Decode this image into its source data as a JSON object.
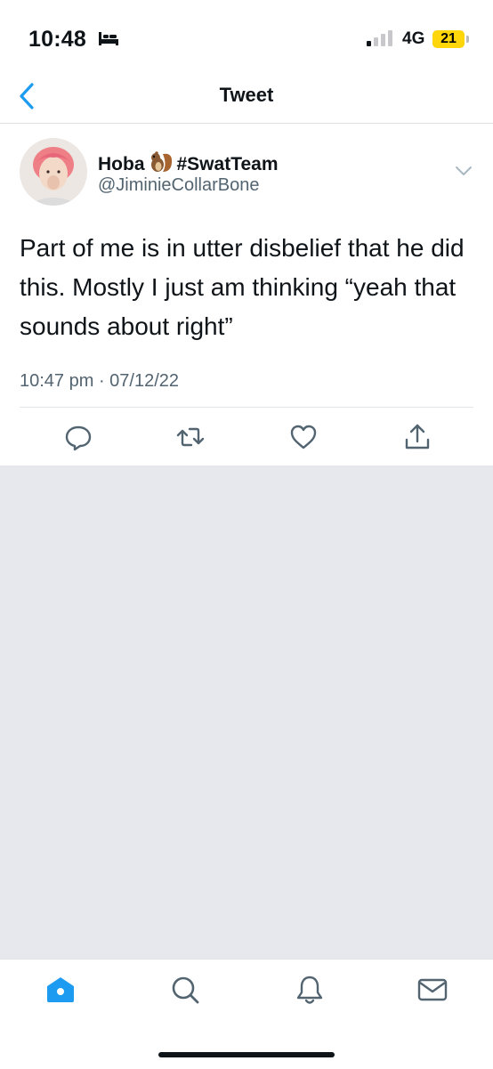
{
  "status_bar": {
    "time": "10:48",
    "network": "4G",
    "battery": "21"
  },
  "nav": {
    "title": "Tweet"
  },
  "tweet": {
    "display_name": "Hoba",
    "display_name_suffix": "#SwatTeam",
    "handle": "@JiminieCollarBone",
    "text": "Part of me is in utter disbelief that he did this. Mostly I just am thinking “yeah that sounds about right”",
    "timestamp": "10:47 pm · 07/12/22"
  },
  "icons": {
    "back": "chevron-left-icon",
    "caret": "chevron-down-icon",
    "reply": "reply-icon",
    "retweet": "retweet-icon",
    "like": "heart-icon",
    "share": "share-icon",
    "home": "home-icon",
    "search": "search-icon",
    "notifications": "bell-icon",
    "messages": "mail-icon"
  },
  "colors": {
    "accent": "#1d9bf0",
    "icon_gray": "#536471",
    "background_empty": "#e6e8ed",
    "battery": "#ffd60a"
  }
}
